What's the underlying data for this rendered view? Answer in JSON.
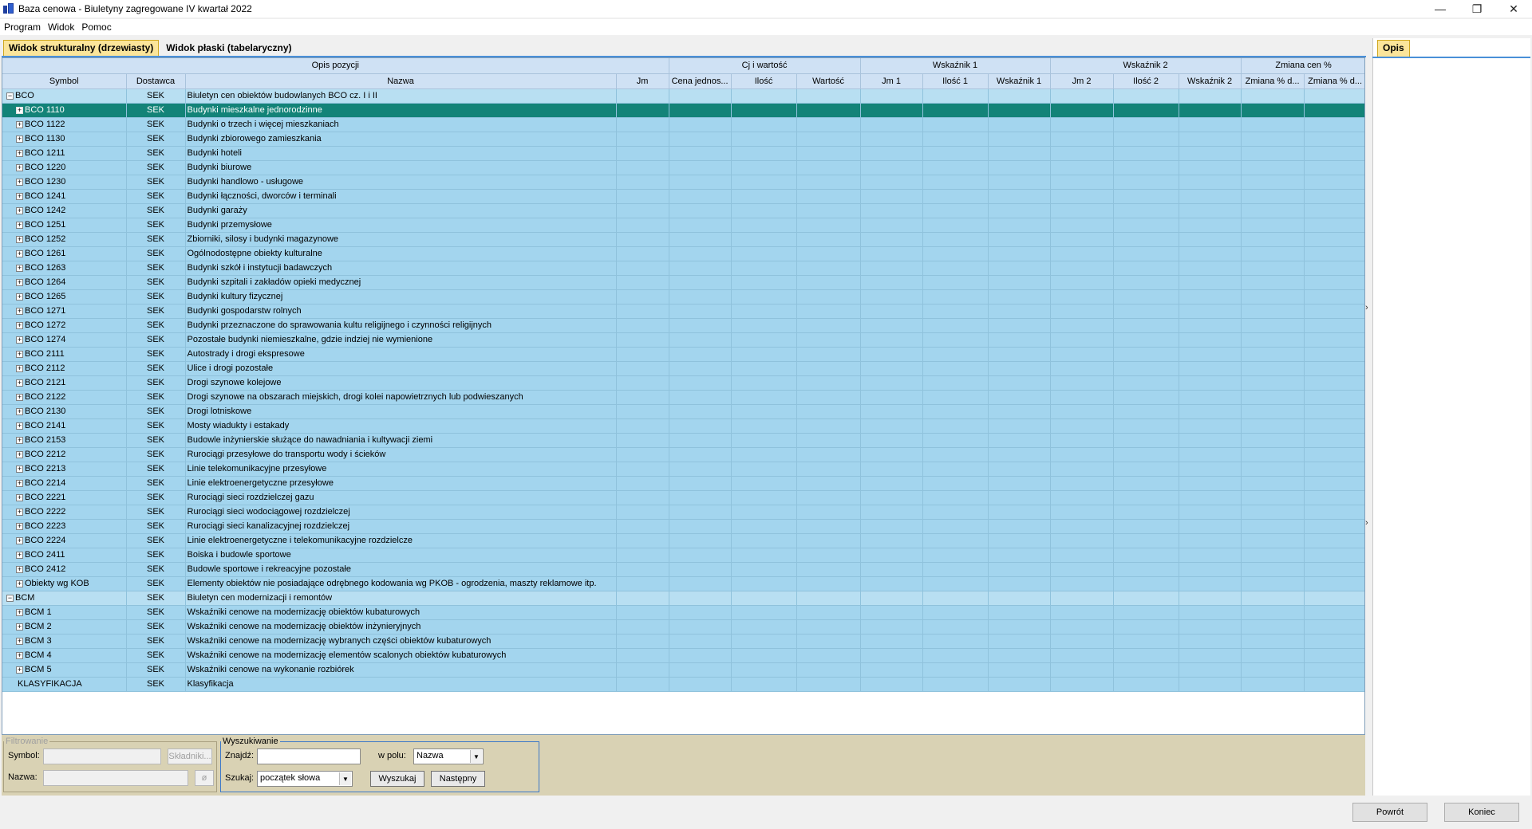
{
  "window": {
    "title": "Baza cenowa - Biuletyny zagregowane IV kwartał 2022"
  },
  "menu": [
    "Program",
    "Widok",
    "Pomoc"
  ],
  "tabs": [
    "Widok strukturalny (drzewiasty)",
    "Widok płaski (tabelaryczny)"
  ],
  "side_panel": {
    "tab": "Opis"
  },
  "grid": {
    "group_headers": [
      "Opis pozycji",
      "Cj i wartość",
      "Wskaźnik 1",
      "Wskaźnik 2",
      "Zmiana cen %"
    ],
    "columns": [
      "Symbol",
      "Dostawca",
      "Nazwa",
      "Jm",
      "Cena jednos...",
      "Ilość",
      "Wartość",
      "Jm 1",
      "Ilość 1",
      "Wskaźnik 1",
      "Jm 2",
      "Ilość 2",
      "Wskaźnik 2",
      "Zmiana % d...",
      "Zmiana % d..."
    ],
    "rows": [
      {
        "symbol": "BCO",
        "supplier": "SEK",
        "name": "Biuletyn cen obiektów budowlanych BCO cz. I i II",
        "level": 0,
        "expander": "−",
        "state": "group"
      },
      {
        "symbol": "BCO 1110",
        "supplier": "SEK",
        "name": "Budynki mieszkalne jednorodzinne",
        "level": 1,
        "expander": "+",
        "state": "selected"
      },
      {
        "symbol": "BCO 1122",
        "supplier": "SEK",
        "name": "Budynki o trzech i więcej mieszkaniach",
        "level": 1,
        "expander": "+",
        "state": ""
      },
      {
        "symbol": "BCO 1130",
        "supplier": "SEK",
        "name": "Budynki zbiorowego zamieszkania",
        "level": 1,
        "expander": "+",
        "state": ""
      },
      {
        "symbol": "BCO 1211",
        "supplier": "SEK",
        "name": "Budynki hoteli",
        "level": 1,
        "expander": "+",
        "state": ""
      },
      {
        "symbol": "BCO 1220",
        "supplier": "SEK",
        "name": "Budynki biurowe",
        "level": 1,
        "expander": "+",
        "state": ""
      },
      {
        "symbol": "BCO 1230",
        "supplier": "SEK",
        "name": "Budynki handlowo - usługowe",
        "level": 1,
        "expander": "+",
        "state": ""
      },
      {
        "symbol": "BCO 1241",
        "supplier": "SEK",
        "name": "Budynki łączności, dworców i terminali",
        "level": 1,
        "expander": "+",
        "state": ""
      },
      {
        "symbol": "BCO 1242",
        "supplier": "SEK",
        "name": "Budynki garaży",
        "level": 1,
        "expander": "+",
        "state": ""
      },
      {
        "symbol": "BCO 1251",
        "supplier": "SEK",
        "name": "Budynki przemysłowe",
        "level": 1,
        "expander": "+",
        "state": ""
      },
      {
        "symbol": "BCO 1252",
        "supplier": "SEK",
        "name": "Zbiorniki, silosy i budynki magazynowe",
        "level": 1,
        "expander": "+",
        "state": ""
      },
      {
        "symbol": "BCO 1261",
        "supplier": "SEK",
        "name": "Ogólnodostępne obiekty kulturalne",
        "level": 1,
        "expander": "+",
        "state": ""
      },
      {
        "symbol": "BCO 1263",
        "supplier": "SEK",
        "name": "Budynki szkół i instytucji badawczych",
        "level": 1,
        "expander": "+",
        "state": ""
      },
      {
        "symbol": "BCO 1264",
        "supplier": "SEK",
        "name": "Budynki szpitali i zakładów opieki medycznej",
        "level": 1,
        "expander": "+",
        "state": ""
      },
      {
        "symbol": "BCO 1265",
        "supplier": "SEK",
        "name": "Budynki kultury fizycznej",
        "level": 1,
        "expander": "+",
        "state": ""
      },
      {
        "symbol": "BCO 1271",
        "supplier": "SEK",
        "name": "Budynki gospodarstw rolnych",
        "level": 1,
        "expander": "+",
        "state": ""
      },
      {
        "symbol": "BCO 1272",
        "supplier": "SEK",
        "name": "Budynki przeznaczone do sprawowania kultu religijnego i czynności religijnych",
        "level": 1,
        "expander": "+",
        "state": ""
      },
      {
        "symbol": "BCO 1274",
        "supplier": "SEK",
        "name": "Pozostałe budynki niemieszkalne, gdzie indziej nie wymienione",
        "level": 1,
        "expander": "+",
        "state": ""
      },
      {
        "symbol": "BCO 2111",
        "supplier": "SEK",
        "name": "Autostrady i drogi ekspresowe",
        "level": 1,
        "expander": "+",
        "state": ""
      },
      {
        "symbol": "BCO 2112",
        "supplier": "SEK",
        "name": "Ulice i drogi pozostałe",
        "level": 1,
        "expander": "+",
        "state": ""
      },
      {
        "symbol": "BCO 2121",
        "supplier": "SEK",
        "name": "Drogi szynowe kolejowe",
        "level": 1,
        "expander": "+",
        "state": ""
      },
      {
        "symbol": "BCO 2122",
        "supplier": "SEK",
        "name": "Drogi szynowe na obszarach miejskich, drogi kolei napowietrznych lub podwieszanych",
        "level": 1,
        "expander": "+",
        "state": ""
      },
      {
        "symbol": "BCO 2130",
        "supplier": "SEK",
        "name": "Drogi lotniskowe",
        "level": 1,
        "expander": "+",
        "state": ""
      },
      {
        "symbol": "BCO 2141",
        "supplier": "SEK",
        "name": "Mosty wiadukty i estakady",
        "level": 1,
        "expander": "+",
        "state": ""
      },
      {
        "symbol": "BCO 2153",
        "supplier": "SEK",
        "name": "Budowle inżynierskie służące do nawadniania i kultywacji ziemi",
        "level": 1,
        "expander": "+",
        "state": ""
      },
      {
        "symbol": "BCO 2212",
        "supplier": "SEK",
        "name": "Rurociągi przesyłowe do transportu wody i ścieków",
        "level": 1,
        "expander": "+",
        "state": ""
      },
      {
        "symbol": "BCO 2213",
        "supplier": "SEK",
        "name": "Linie telekomunikacyjne przesyłowe",
        "level": 1,
        "expander": "+",
        "state": ""
      },
      {
        "symbol": "BCO 2214",
        "supplier": "SEK",
        "name": "Linie elektroenergetyczne przesyłowe",
        "level": 1,
        "expander": "+",
        "state": ""
      },
      {
        "symbol": "BCO 2221",
        "supplier": "SEK",
        "name": "Rurociągi sieci rozdzielczej gazu",
        "level": 1,
        "expander": "+",
        "state": ""
      },
      {
        "symbol": "BCO 2222",
        "supplier": "SEK",
        "name": "Rurociągi sieci wodociągowej rozdzielczej",
        "level": 1,
        "expander": "+",
        "state": ""
      },
      {
        "symbol": "BCO 2223",
        "supplier": "SEK",
        "name": "Rurociągi sieci kanalizacyjnej rozdzielczej",
        "level": 1,
        "expander": "+",
        "state": ""
      },
      {
        "symbol": "BCO 2224",
        "supplier": "SEK",
        "name": "Linie elektroenergetyczne i telekomunikacyjne rozdzielcze",
        "level": 1,
        "expander": "+",
        "state": ""
      },
      {
        "symbol": "BCO 2411",
        "supplier": "SEK",
        "name": "Boiska i budowle sportowe",
        "level": 1,
        "expander": "+",
        "state": ""
      },
      {
        "symbol": "BCO 2412",
        "supplier": "SEK",
        "name": "Budowle sportowe i rekreacyjne pozostałe",
        "level": 1,
        "expander": "+",
        "state": ""
      },
      {
        "symbol": "Obiekty wg KOB",
        "supplier": "SEK",
        "name": "Elementy obiektów nie posiadające odrębnego kodowania wg PKOB - ogrodzenia, maszty reklamowe itp.",
        "level": 1,
        "expander": "+",
        "state": ""
      },
      {
        "symbol": "BCM",
        "supplier": "SEK",
        "name": "Biuletyn cen modernizacji i remontów",
        "level": 0,
        "expander": "−",
        "state": "group"
      },
      {
        "symbol": "BCM 1",
        "supplier": "SEK",
        "name": "Wskaźniki cenowe na modernizację obiektów kubaturowych",
        "level": 1,
        "expander": "+",
        "state": ""
      },
      {
        "symbol": "BCM 2",
        "supplier": "SEK",
        "name": "Wskaźniki cenowe na modernizację obiektów inżynieryjnych",
        "level": 1,
        "expander": "+",
        "state": ""
      },
      {
        "symbol": "BCM 3",
        "supplier": "SEK",
        "name": "Wskaźniki cenowe na modernizację wybranych części obiektów kubaturowych",
        "level": 1,
        "expander": "+",
        "state": ""
      },
      {
        "symbol": "BCM 4",
        "supplier": "SEK",
        "name": "Wskaźniki cenowe na modernizację elementów scalonych obiektów kubaturowych",
        "level": 1,
        "expander": "+",
        "state": ""
      },
      {
        "symbol": "BCM 5",
        "supplier": "SEK",
        "name": "Wskaźniki cenowe na wykonanie rozbiórek",
        "level": 1,
        "expander": "+",
        "state": ""
      },
      {
        "symbol": "KLASYFIKACJA",
        "supplier": "SEK",
        "name": "Klasyfikacja",
        "level": 0,
        "expander": "",
        "state": ""
      }
    ]
  },
  "filter": {
    "legend": "Filtrowanie",
    "symbol_label": "Symbol:",
    "symbol_value": "",
    "components_button": "Składniki...",
    "name_label": "Nazwa:",
    "name_value": "",
    "clear_button": "ø"
  },
  "search": {
    "legend": "Wyszukiwanie",
    "find_label": "Znajdź:",
    "find_value": "",
    "field_label": "w polu:",
    "field_value": "Nazwa",
    "mode_label": "Szukaj:",
    "mode_value": "początek słowa",
    "search_button": "Wyszukaj",
    "next_button": "Następny"
  },
  "footer": {
    "back_button": "Powrót",
    "end_button": "Koniec"
  }
}
